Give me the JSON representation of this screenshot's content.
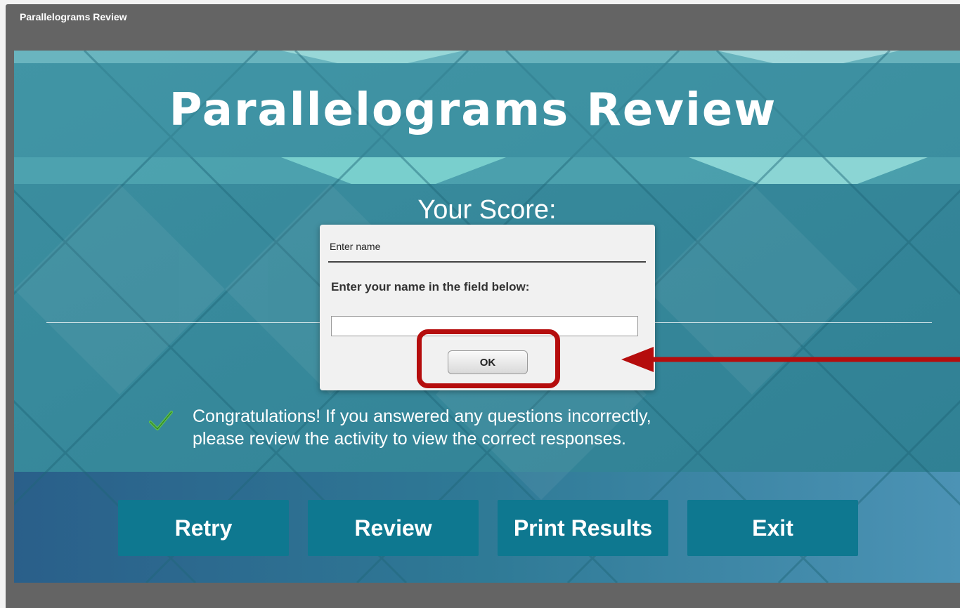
{
  "window": {
    "title": "Parallelograms Review"
  },
  "main": {
    "title": "Parallelograms Review",
    "score_label": "Your Score:",
    "message_line1": "Congratulations! If you answered any questions incorrectly,",
    "message_line2": "please review the activity to view the correct responses."
  },
  "actions": {
    "retry": "Retry",
    "review": "Review",
    "print_results": "Print Results",
    "exit": "Exit"
  },
  "dialog": {
    "title": "Enter name",
    "prompt": "Enter your name in the field below:",
    "input_value": "",
    "ok_label": "OK"
  },
  "icons": {
    "check": "check-icon",
    "arrow": "arrow-icon"
  },
  "colors": {
    "button": "#0e7890",
    "highlight": "#b50d0d",
    "window_frame": "#646464",
    "background_teal": "#3b8e9e"
  }
}
